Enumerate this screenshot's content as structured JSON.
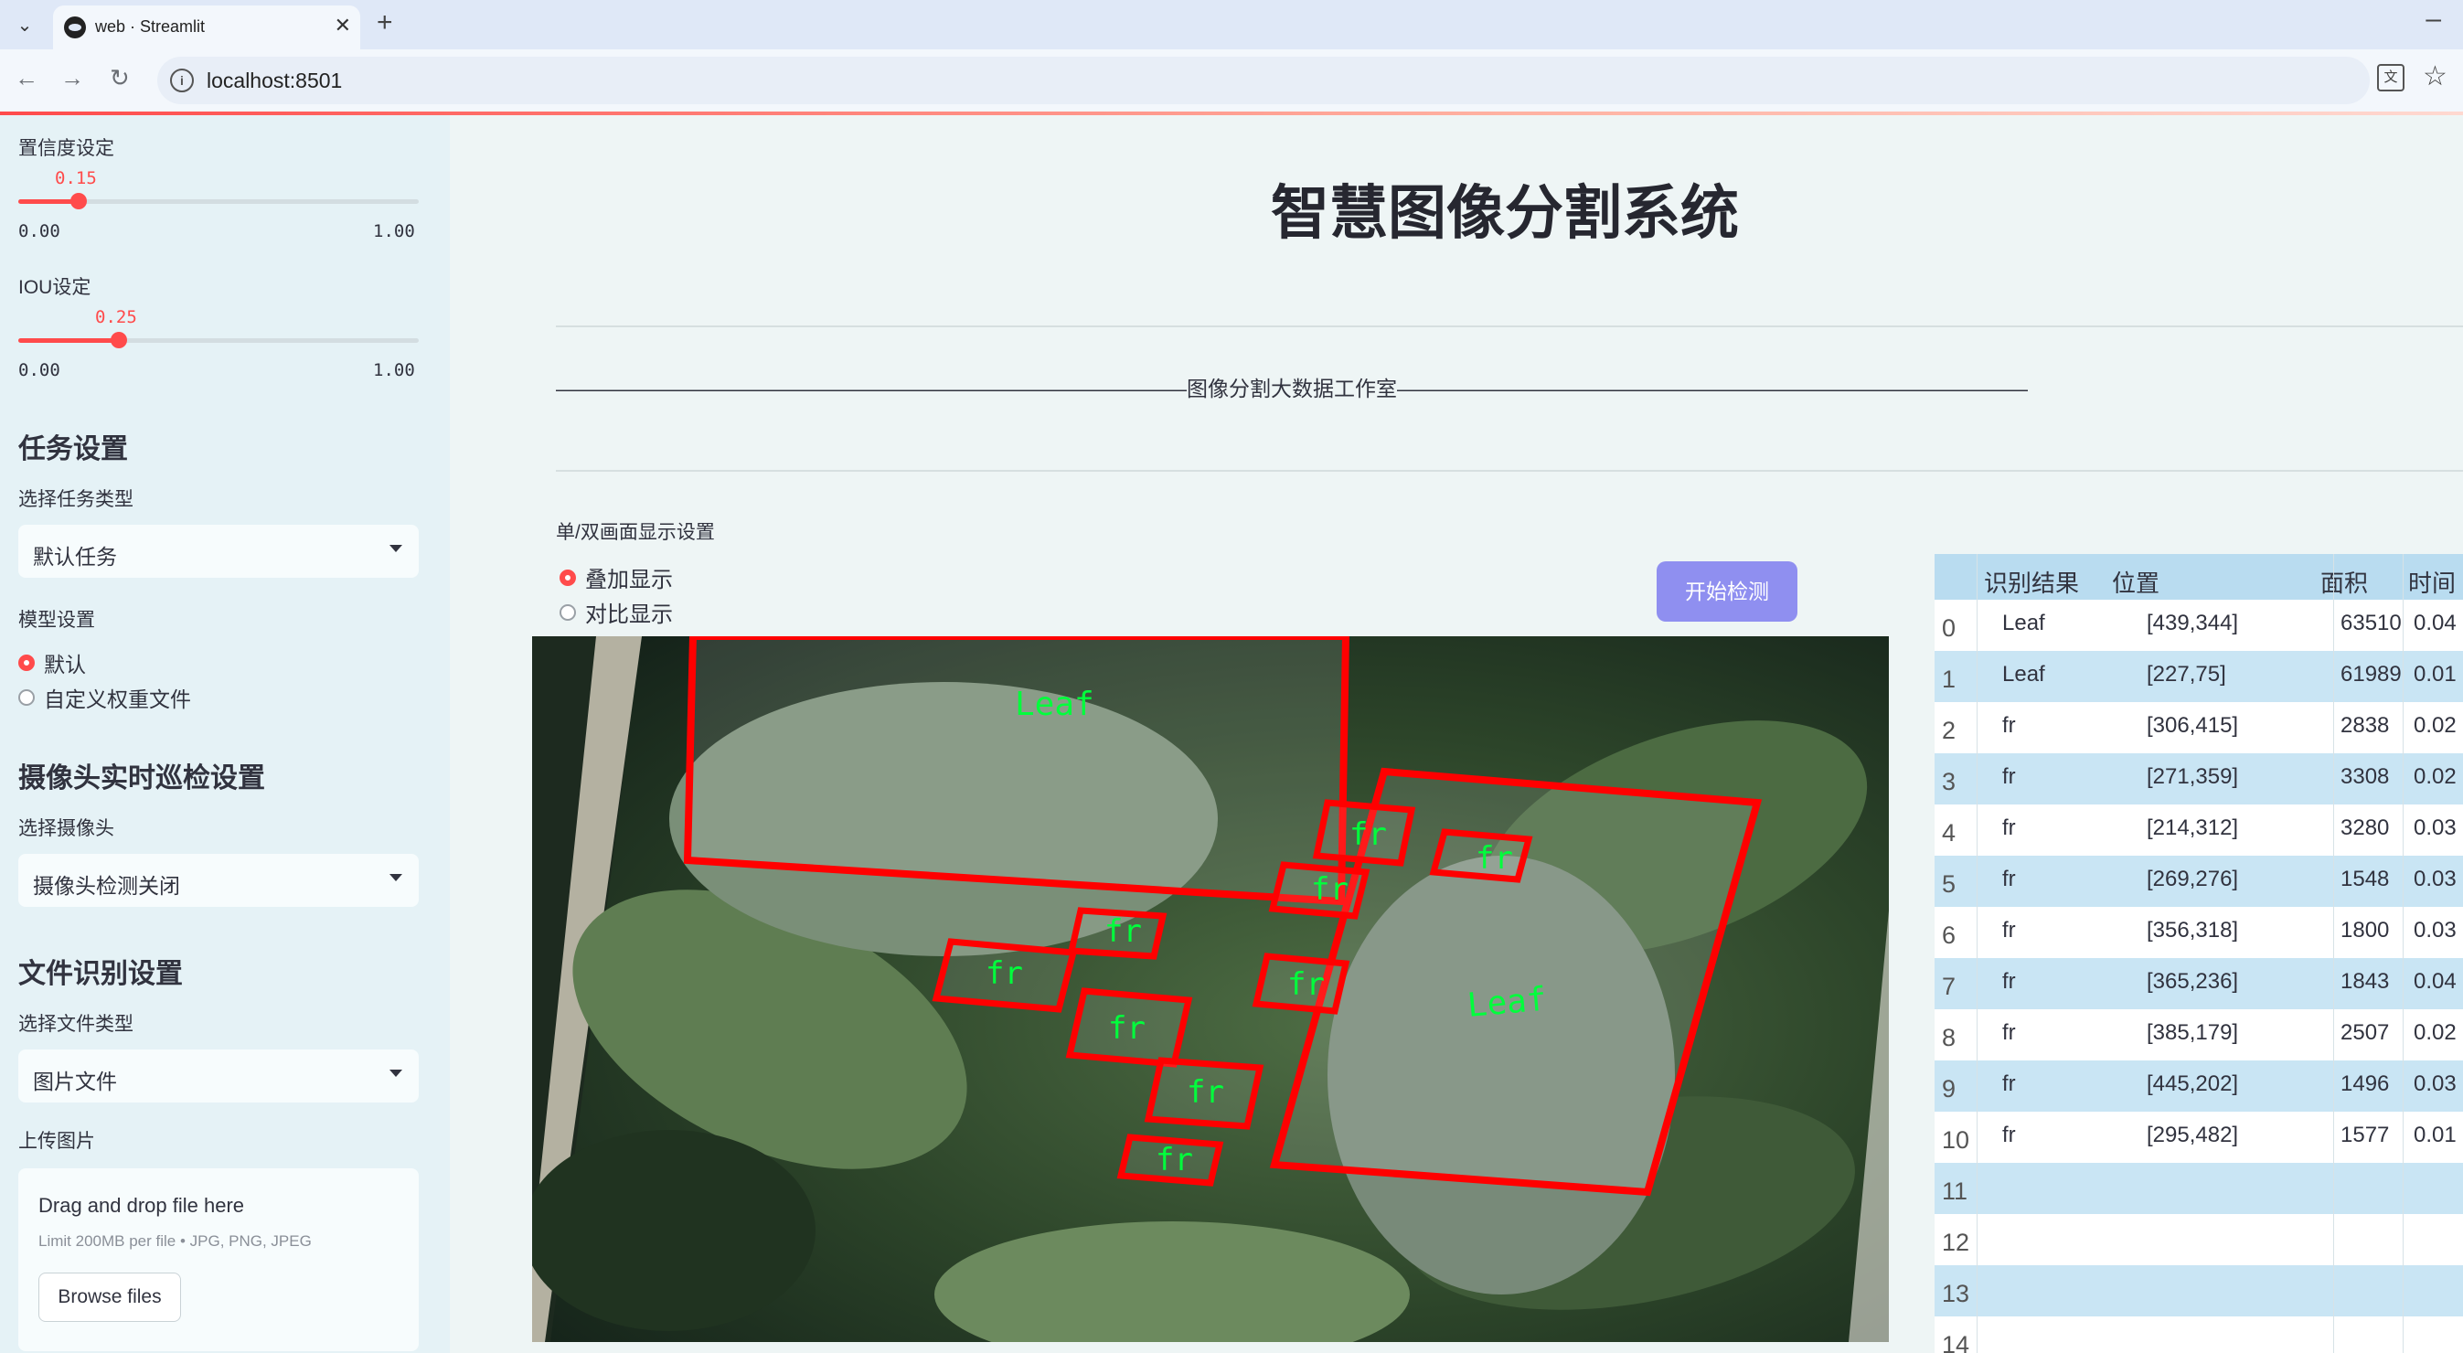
{
  "browser": {
    "tab_title": "web · Streamlit",
    "url": "localhost:8501",
    "icons": [
      "tab-menu-icon",
      "close-icon",
      "new-tab-icon",
      "minimize-icon",
      "back-icon",
      "forward-icon",
      "reload-icon",
      "info-icon",
      "translate-icon",
      "star-icon"
    ]
  },
  "sidebar": {
    "confidence": {
      "label": "置信度设定",
      "value": "0.15",
      "min": "0.00",
      "max": "1.00",
      "fraction": 0.15
    },
    "iou": {
      "label": "IOU设定",
      "value": "0.25",
      "min": "0.00",
      "max": "1.00",
      "fraction": 0.25
    },
    "task": {
      "heading": "任务设置",
      "label": "选择任务类型",
      "selected": "默认任务"
    },
    "model": {
      "label": "模型设置",
      "options": [
        "默认",
        "自定义权重文件"
      ],
      "selected_index": 0
    },
    "camera": {
      "heading": "摄像头实时巡检设置",
      "label": "选择摄像头",
      "selected": "摄像头检测关闭"
    },
    "file": {
      "heading": "文件识别设置",
      "label": "选择文件类型",
      "selected": "图片文件"
    },
    "upload": {
      "label": "上传图片",
      "drop_text": "Drag and drop file here",
      "limit_text": "Limit 200MB per file • JPG, PNG, JPEG",
      "browse_label": "Browse files"
    }
  },
  "main": {
    "title": "智慧图像分割系统",
    "divider_text": "——————————————————————————————图像分割大数据工作室——————————————————————————————",
    "display_mode": {
      "label": "单/双画面显示设置",
      "options": [
        "叠加显示",
        "对比显示"
      ],
      "selected_index": 0
    },
    "start_button": "开始检测",
    "colors": {
      "accent": "#ff4b4b",
      "button": "#8f8ff0",
      "box": "#ff0000",
      "label_text": "#00ff3c"
    },
    "detections_overlay": [
      "Leaf",
      "Leaf",
      "fr",
      "fr",
      "fr",
      "fr",
      "fr",
      "fr",
      "fr",
      "fr",
      "fr"
    ]
  },
  "table": {
    "headers": [
      "识别结果",
      "位置",
      "面积",
      "时间"
    ],
    "rows": [
      {
        "index": "0",
        "result": "Leaf",
        "position": "[439,344]",
        "area": "63510",
        "time": "0.04"
      },
      {
        "index": "1",
        "result": "Leaf",
        "position": "[227,75]",
        "area": "61989",
        "time": "0.01"
      },
      {
        "index": "2",
        "result": "fr",
        "position": "[306,415]",
        "area": "2838",
        "time": "0.02"
      },
      {
        "index": "3",
        "result": "fr",
        "position": "[271,359]",
        "area": "3308",
        "time": "0.02"
      },
      {
        "index": "4",
        "result": "fr",
        "position": "[214,312]",
        "area": "3280",
        "time": "0.03"
      },
      {
        "index": "5",
        "result": "fr",
        "position": "[269,276]",
        "area": "1548",
        "time": "0.03"
      },
      {
        "index": "6",
        "result": "fr",
        "position": "[356,318]",
        "area": "1800",
        "time": "0.03"
      },
      {
        "index": "7",
        "result": "fr",
        "position": "[365,236]",
        "area": "1843",
        "time": "0.04"
      },
      {
        "index": "8",
        "result": "fr",
        "position": "[385,179]",
        "area": "2507",
        "time": "0.02"
      },
      {
        "index": "9",
        "result": "fr",
        "position": "[445,202]",
        "area": "1496",
        "time": "0.03"
      },
      {
        "index": "10",
        "result": "fr",
        "position": "[295,482]",
        "area": "1577",
        "time": "0.01"
      },
      {
        "index": "11",
        "result": "",
        "position": "",
        "area": "",
        "time": ""
      },
      {
        "index": "12",
        "result": "",
        "position": "",
        "area": "",
        "time": ""
      },
      {
        "index": "13",
        "result": "",
        "position": "",
        "area": "",
        "time": ""
      },
      {
        "index": "14",
        "result": "",
        "position": "",
        "area": "",
        "time": ""
      }
    ]
  }
}
